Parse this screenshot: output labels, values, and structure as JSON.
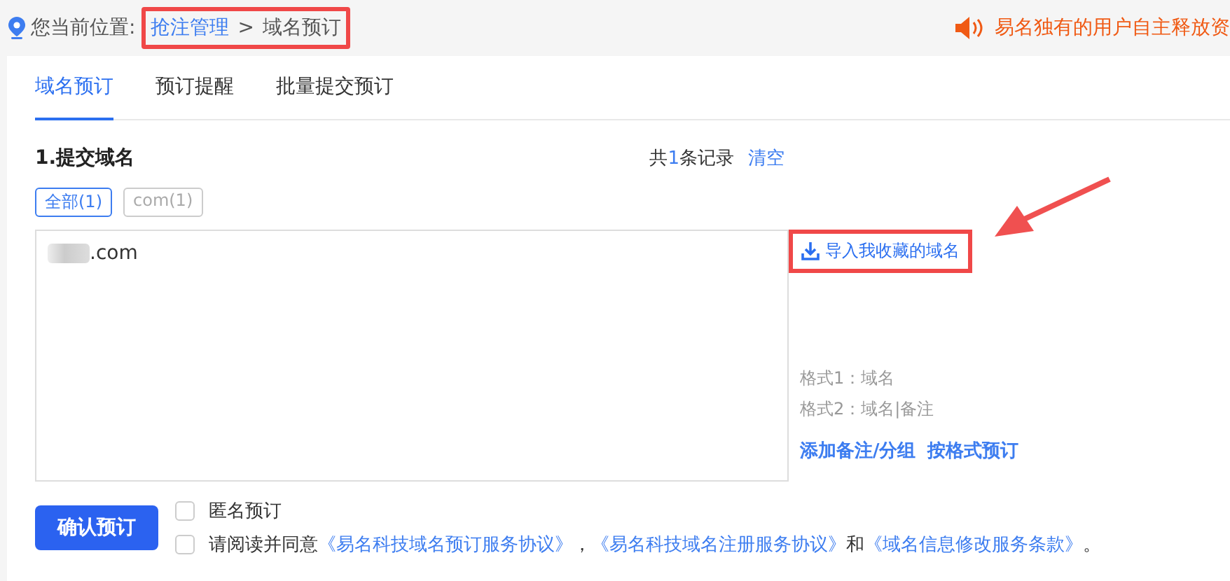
{
  "breadcrumb": {
    "label": "您当前位置:",
    "highlighted": true,
    "items": [
      {
        "text": "抢注管理",
        "kind": "link"
      },
      {
        "text": ">",
        "kind": "separator"
      },
      {
        "text": "域名预订",
        "kind": "current"
      }
    ]
  },
  "notice": {
    "text": "易名独有的用户自主释放资"
  },
  "tabs": [
    {
      "label": "域名预订",
      "selected": true
    },
    {
      "label": "预订提醒",
      "selected": false
    },
    {
      "label": "批量提交预订",
      "selected": false
    }
  ],
  "section_title": "1.提交域名",
  "record_count": {
    "prefix": "共",
    "count": "1",
    "suffix": "条记录"
  },
  "clear_link": "清空",
  "filters": [
    {
      "label": "全部(1)",
      "selected": true
    },
    {
      "label": "com(1)",
      "selected": false
    }
  ],
  "domain_input": {
    "value": ".com",
    "redacted": true
  },
  "import_link": {
    "text": "导入我收藏的域名",
    "highlighted": true
  },
  "formats": [
    "格式1：域名",
    "格式2：域名|备注"
  ],
  "actions": [
    "添加备注/分组",
    "按格式预订"
  ],
  "submit_button": "确认预订",
  "anonymous_option": {
    "checked": false,
    "label": "匿名预订"
  },
  "agreement": {
    "checked": false,
    "parts": [
      {
        "kind": "text",
        "text": "请阅读并同意"
      },
      {
        "kind": "link",
        "text": "《易名科技域名预订服务协议》"
      },
      {
        "kind": "text",
        "text": "，"
      },
      {
        "kind": "link",
        "text": "《易名科技域名注册服务协议》"
      },
      {
        "kind": "text",
        "text": "和"
      },
      {
        "kind": "link",
        "text": "《域名信息修改服务条款》"
      },
      {
        "kind": "text",
        "text": "。"
      }
    ]
  }
}
